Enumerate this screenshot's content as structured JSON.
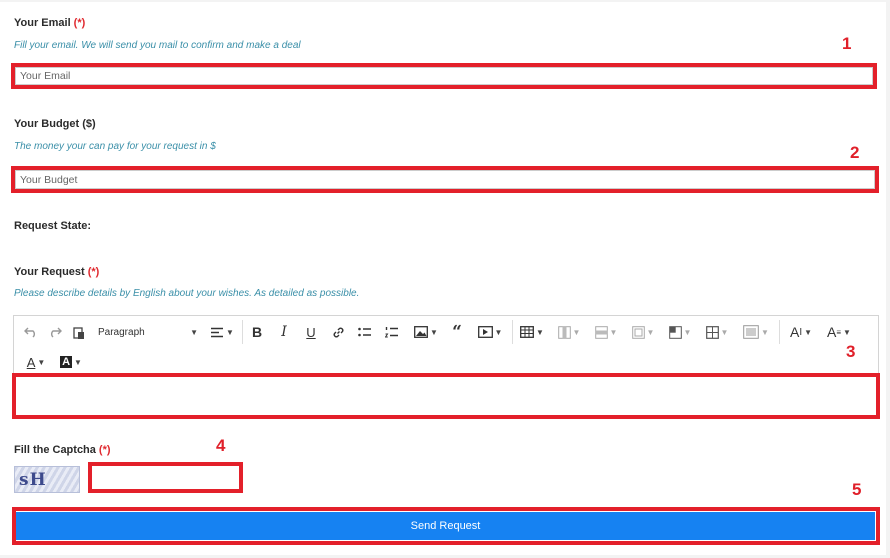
{
  "email": {
    "label": "Your Email",
    "required": "(*)",
    "hint": "Fill your email. We will send you mail to confirm and make a deal",
    "placeholder": "Your Email",
    "marker": "1"
  },
  "budget": {
    "label": "Your Budget ($)",
    "hint": "The money your can pay for your request in $",
    "placeholder": "Your Budget",
    "marker": "2"
  },
  "state": {
    "label": "Request State:"
  },
  "request": {
    "label": "Your Request",
    "required": "(*)",
    "hint": "Please describe details by English about your wishes. As detailed as possible.",
    "marker": "3",
    "toolbar": {
      "paragraph_select": "Paragraph",
      "icons": [
        "undo-icon",
        "redo-icon",
        "paste-icon",
        "align-icon",
        "bold-icon",
        "italic-icon",
        "underline-icon",
        "link-icon",
        "bullet-list-icon",
        "numbered-list-icon",
        "image-icon",
        "quote-icon",
        "media-icon",
        "table-icon",
        "column-icon",
        "row-icon",
        "merge-cells-icon",
        "cell-properties-icon",
        "table-properties-icon",
        "cell-background-icon",
        "font-size-icon",
        "text-style-icon",
        "font-color-icon",
        "font-background-icon"
      ]
    }
  },
  "captcha": {
    "label": "Fill the Captcha",
    "required": "(*)",
    "image_text": "sH",
    "marker": "4"
  },
  "submit": {
    "label": "Send Request",
    "marker": "5"
  },
  "colors": {
    "highlight": "#e3202a",
    "button": "#1682f2",
    "hint": "#3a8fa8"
  }
}
